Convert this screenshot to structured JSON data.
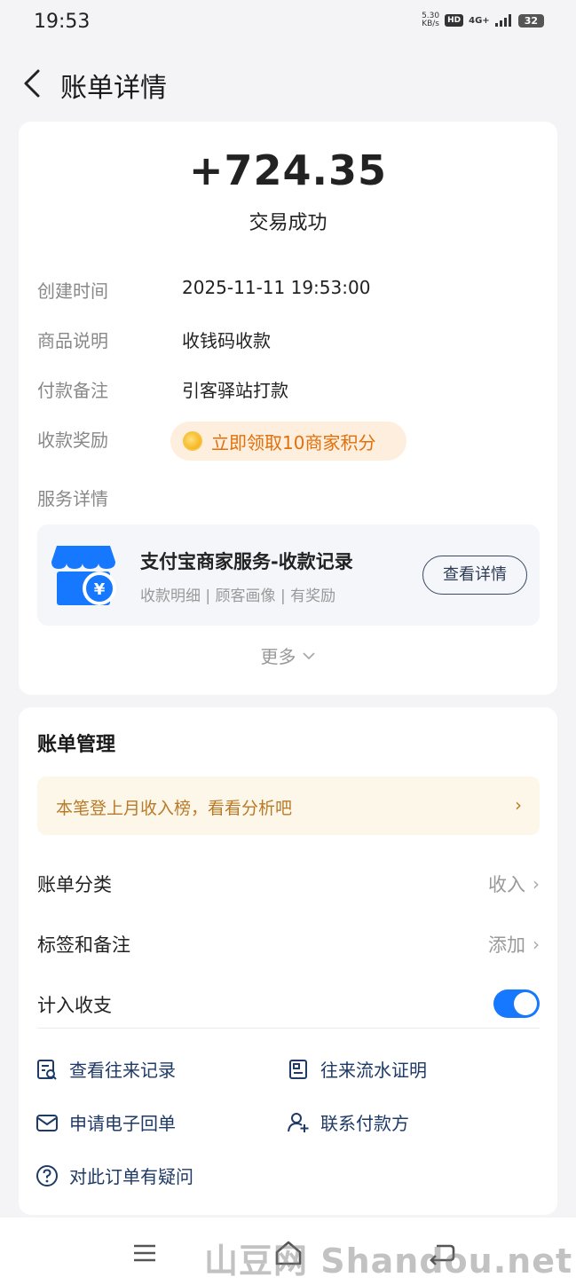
{
  "status_bar": {
    "time": "19:53",
    "net_speed_value": "5.30",
    "net_speed_unit": "KB/s",
    "hd_badge": "HD",
    "signal": "4G+",
    "battery": "32"
  },
  "header": {
    "title": "账单详情",
    "back_icon": "chevron-left-icon"
  },
  "transaction": {
    "amount": "+724.35",
    "status": "交易成功",
    "rows": [
      {
        "label": "创建时间",
        "value": "2025-11-11 19:53:00"
      },
      {
        "label": "商品说明",
        "value": "收钱码收款"
      },
      {
        "label": "付款备注",
        "value": "引客驿站打款"
      },
      {
        "label": "收款奖励",
        "value": "立即领取10商家积分"
      }
    ],
    "service_details_label": "服务详情",
    "service": {
      "icon": "shop-icon",
      "title": "支付宝商家服务-收款记录",
      "subtitle": "收款明细 | 顾客画像 | 有奖励",
      "button_label": "查看详情"
    },
    "more_label": "更多"
  },
  "bill_management": {
    "title": "账单管理",
    "tip": "本笔登上月收入榜，看看分析吧",
    "items": [
      {
        "label": "账单分类",
        "value": "收入"
      },
      {
        "label": "标签和备注",
        "value": "添加"
      }
    ],
    "toggle_label": "计入收支",
    "toggle_on": true,
    "actions": [
      {
        "label": "查看往来记录",
        "icon": "search-document-icon"
      },
      {
        "label": "往来流水证明",
        "icon": "certificate-icon"
      },
      {
        "label": "申请电子回单",
        "icon": "mail-icon"
      },
      {
        "label": "联系付款方",
        "icon": "add-contact-icon"
      },
      {
        "label": "对此订单有疑问",
        "icon": "question-icon"
      }
    ]
  },
  "navbar": {
    "menu_icon": "menu-icon",
    "home_icon": "home-icon",
    "back_icon": "back-icon"
  },
  "watermark": "山豆网 Shandou.net",
  "colors": {
    "accent": "#1677ff",
    "reward_text": "#e2700a",
    "tip_text": "#b97a28",
    "action_text": "#1f3a66"
  }
}
